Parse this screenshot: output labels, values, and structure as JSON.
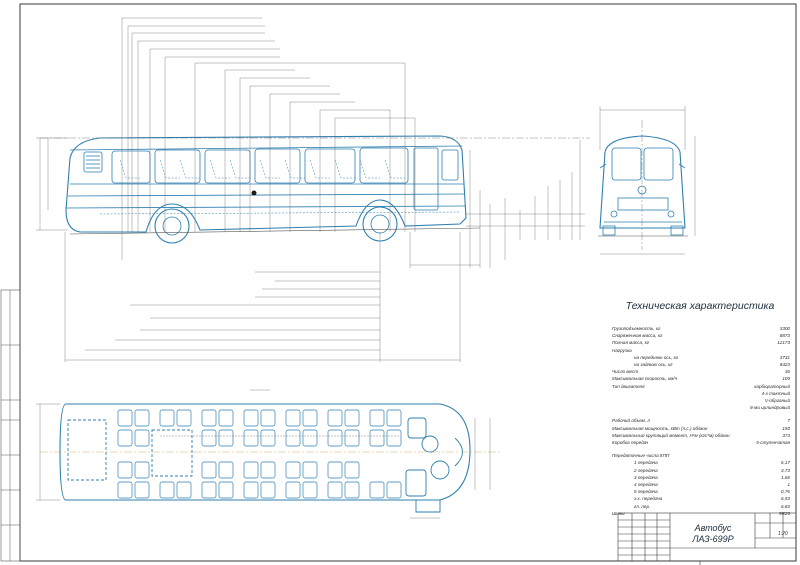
{
  "specs": {
    "title": "Техническая характеристика",
    "rows": [
      {
        "label": "Грузоподъемность, кг",
        "value": "3300"
      },
      {
        "label": "Снаряженная масса, кг",
        "value": "8873"
      },
      {
        "label": "Полная масса, кг",
        "value": "12173"
      },
      {
        "label": "Нагрузка",
        "value": ""
      },
      {
        "label": "на переднюю ось, кг",
        "value": "3731"
      },
      {
        "label": "на заднюю ось, кг",
        "value": "8423"
      },
      {
        "label": "Число мест",
        "value": "36"
      },
      {
        "label": "Максимальная скорость, км/ч",
        "value": "100"
      },
      {
        "label": "Тип двигателя",
        "value": "карбюраторный"
      },
      {
        "label": "",
        "value": "4-х тактный"
      },
      {
        "label": "",
        "value": "V-образный"
      },
      {
        "label": "",
        "value": "8-ми цилиндровый"
      },
      {
        "label": "Рабочий объем, л",
        "value": "7"
      },
      {
        "label": "Максимальная мощность, кВт (л.с.) об/мин",
        "value": "150"
      },
      {
        "label": "Максимальный крутящий момент, Н*м (кгс*м) об/мин",
        "value": "373"
      },
      {
        "label": "Коробка передач",
        "value": "5-ступенчатая"
      },
      {
        "label": "Передаточные числа КПП",
        "value": ""
      },
      {
        "label": "1 передача",
        "value": "6,17"
      },
      {
        "label": "2 передача",
        "value": "3,73"
      },
      {
        "label": "3 передача",
        "value": "1,66"
      },
      {
        "label": "4 передача",
        "value": "1"
      },
      {
        "label": "5 передача",
        "value": "0,76"
      },
      {
        "label": "з.х. передача",
        "value": "6,53"
      },
      {
        "label": "гл. пер.",
        "value": "6,83"
      },
      {
        "label": "Шины",
        "value": "9R20"
      }
    ]
  },
  "title_block": {
    "name_line1": "Автобус",
    "name_line2": "ЛАЗ-699Р",
    "sheet_label": "1:20"
  },
  "colors": {
    "lines": "#2f7fb0",
    "dims": "#6a6a6a",
    "frame": "#3a3a3a"
  }
}
